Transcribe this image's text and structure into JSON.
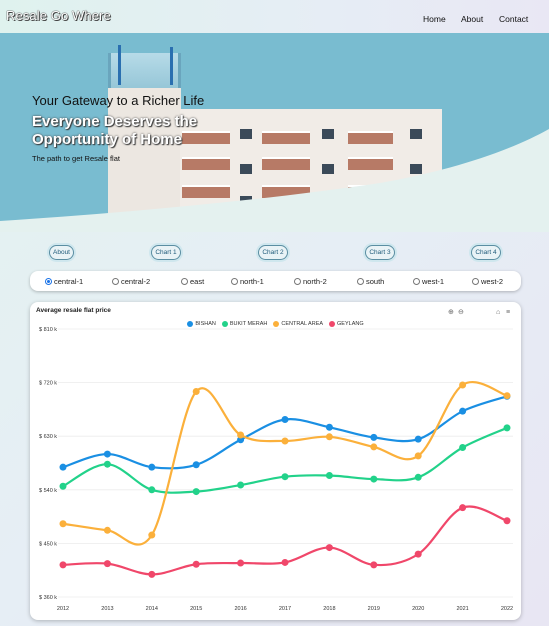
{
  "brand": "Resale Go Where",
  "nav": {
    "home": "Home",
    "about": "About",
    "contact": "Contact"
  },
  "hero": {
    "title": "Your Gateway to a Richer Life",
    "headline": "Everyone Deserves the Opportunity of Home",
    "subtitle": "The path to get Resale flat"
  },
  "pills": [
    "About",
    "Chart 1",
    "Chart 2",
    "Chart 3",
    "Chart 4"
  ],
  "regions": {
    "selected": "central-1",
    "options": [
      "central-1",
      "central-2",
      "east",
      "north-1",
      "north-2",
      "south",
      "west-1",
      "west-2"
    ]
  },
  "toolbar": {
    "zoom_in": "+",
    "zoom_out": "−",
    "home": "⌂",
    "menu": "≡"
  },
  "colors": {
    "bishan": "#1a8fe3",
    "bukit_merah": "#22d28a",
    "central_area": "#fbb03b",
    "geylang": "#f0476a"
  },
  "chart_data": {
    "type": "line",
    "title": "Average resale flat price",
    "x": [
      "2012",
      "2013",
      "2014",
      "2015",
      "2016",
      "2017",
      "2018",
      "2019",
      "2020",
      "2021",
      "2022"
    ],
    "y_ticks": [
      "$ 810 k",
      "$ 720 k",
      "$ 630 k",
      "$ 540 k",
      "$ 450 k",
      "$ 360 k"
    ],
    "ylim": [
      360,
      810
    ],
    "series": [
      {
        "name": "BISHAN",
        "color": "#1a8fe3",
        "values": [
          578,
          600,
          578,
          582,
          624,
          658,
          645,
          628,
          625,
          672,
          697
        ]
      },
      {
        "name": "BUKIT MERAH",
        "color": "#22d28a",
        "values": [
          546,
          583,
          540,
          537,
          548,
          562,
          564,
          558,
          561,
          611,
          644
        ]
      },
      {
        "name": "CENTRAL AREA",
        "color": "#fbb03b",
        "values": [
          483,
          472,
          464,
          705,
          632,
          622,
          629,
          612,
          597,
          716,
          698
        ]
      },
      {
        "name": "GEYLANG",
        "color": "#f0476a",
        "values": [
          414,
          416,
          398,
          415,
          417,
          418,
          443,
          414,
          432,
          510,
          488
        ]
      }
    ]
  }
}
